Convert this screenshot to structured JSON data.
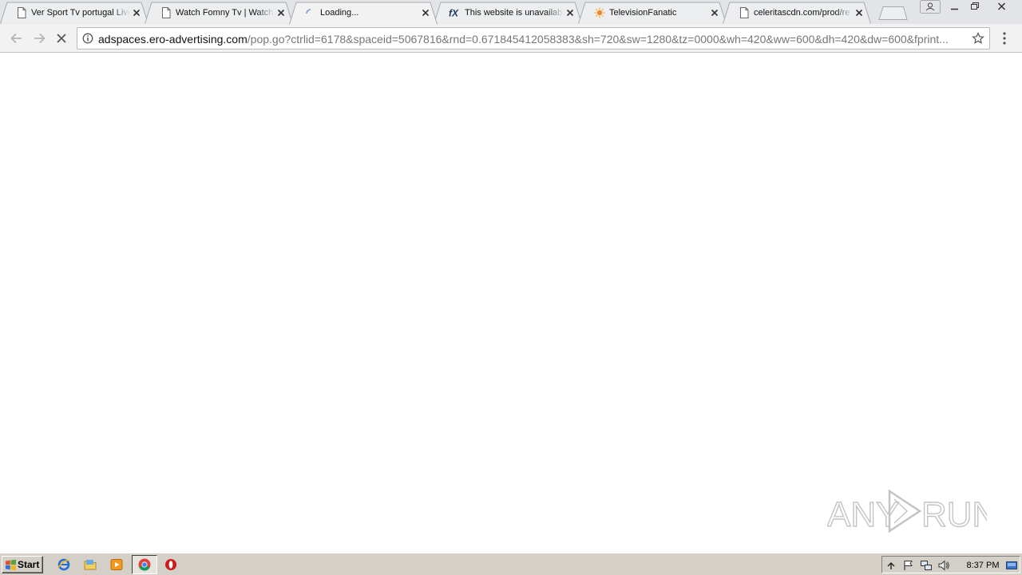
{
  "browser": {
    "tabs": [
      {
        "title": "Ver Sport Tv portugal Live",
        "icon": "document-icon",
        "active": false
      },
      {
        "title": "Watch Fomny Tv | Watch",
        "icon": "document-icon",
        "active": false
      },
      {
        "title": "Loading...",
        "icon": "loading-spinner-icon",
        "active": true
      },
      {
        "title": "This website is unavailable",
        "icon": "fx-logo-icon",
        "active": false
      },
      {
        "title": "TelevisionFanatic",
        "icon": "sun-logo-icon",
        "active": false
      },
      {
        "title": "celeritascdn.com/prod/re",
        "icon": "document-icon",
        "active": false
      }
    ],
    "address": {
      "host": "adspaces.ero-advertising.com",
      "path": "/pop.go?ctrlid=6178&spaceid=5067816&rnd=0.671845412058383&sh=720&sw=1280&tz=0000&wh=420&ww=600&dh=420&dw=600&fprint..."
    }
  },
  "watermark": {
    "text_left": "ANY",
    "text_right": "RUN"
  },
  "taskbar": {
    "start_label": "Start",
    "quick_launch": [
      "internet-explorer-icon",
      "folder-icon",
      "media-player-icon",
      "chrome-icon",
      "opera-icon"
    ],
    "tray_icons": [
      "show-hidden-icon",
      "flag-icon",
      "network-icon",
      "volume-icon"
    ],
    "clock": "8:37 PM"
  },
  "colors": {
    "tabstrip": "#e2e4e7",
    "active_tab": "#f2f2f2",
    "taskbar": "#d4d0c8"
  }
}
